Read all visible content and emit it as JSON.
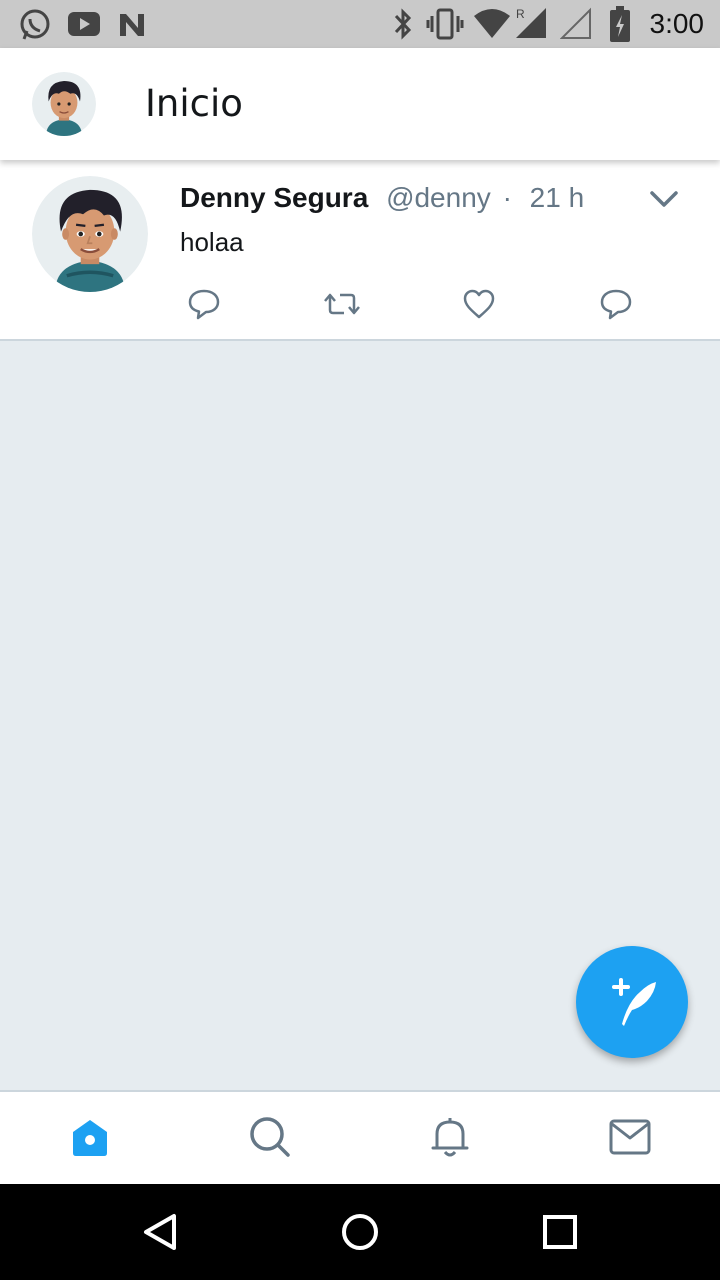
{
  "status_bar": {
    "time": "3:00",
    "icons": [
      "whatsapp-icon",
      "youtube-icon",
      "n-icon",
      "bluetooth-icon",
      "vibrate-icon",
      "wifi-icon",
      "signal-icon",
      "signal-empty-icon",
      "battery-icon"
    ]
  },
  "header": {
    "title": "Inicio",
    "avatar_icon": "avatar"
  },
  "tweet": {
    "author_name": "Denny Segura",
    "handle": "@denny",
    "separator": "·",
    "time": "21 h",
    "text": "holaa",
    "actions": [
      "reply-icon",
      "retweet-icon",
      "like-icon",
      "dm-icon"
    ]
  },
  "fab": {
    "icon": "compose-tweet-icon"
  },
  "bottom_nav": {
    "items": [
      "home-icon",
      "search-icon",
      "notifications-icon",
      "messages-icon"
    ],
    "active": "home-icon"
  },
  "colors": {
    "accent": "#1da1f2",
    "text_primary": "#14171a",
    "text_secondary": "#657786",
    "background": "#e6ecf0",
    "icon_gray": "#657786"
  }
}
